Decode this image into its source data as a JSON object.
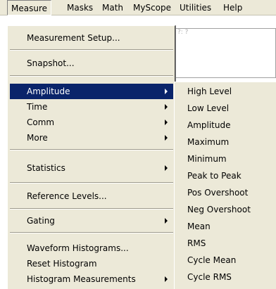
{
  "menubar": {
    "items": [
      "Measure",
      "Masks",
      "Math",
      "MyScope",
      "Utilities",
      "Help"
    ]
  },
  "background": {
    "text": "?: ?"
  },
  "measure_menu": {
    "items": [
      {
        "label": "Measurement Setup..."
      },
      {
        "label": "Snapshot..."
      },
      {
        "label": "Amplitude",
        "submenu": true,
        "selected": true
      },
      {
        "label": "Time",
        "submenu": true
      },
      {
        "label": "Comm",
        "submenu": true
      },
      {
        "label": "More",
        "submenu": true
      },
      {
        "label": "Statistics",
        "submenu": true
      },
      {
        "label": "Reference Levels..."
      },
      {
        "label": "Gating",
        "submenu": true
      },
      {
        "label": "Waveform Histograms..."
      },
      {
        "label": "Reset Histogram"
      },
      {
        "label": "Histogram Measurements",
        "submenu": true
      }
    ]
  },
  "amplitude_submenu": {
    "items": [
      "High Level",
      "Low Level",
      "Amplitude",
      "Maximum",
      "Minimum",
      "Peak to Peak",
      "Pos Overshoot",
      "Neg Overshoot",
      "Mean",
      "RMS",
      "Cycle Mean",
      "Cycle RMS"
    ]
  },
  "colors": {
    "menu_bg": "#ece9d8",
    "selection": "#0a246a"
  }
}
